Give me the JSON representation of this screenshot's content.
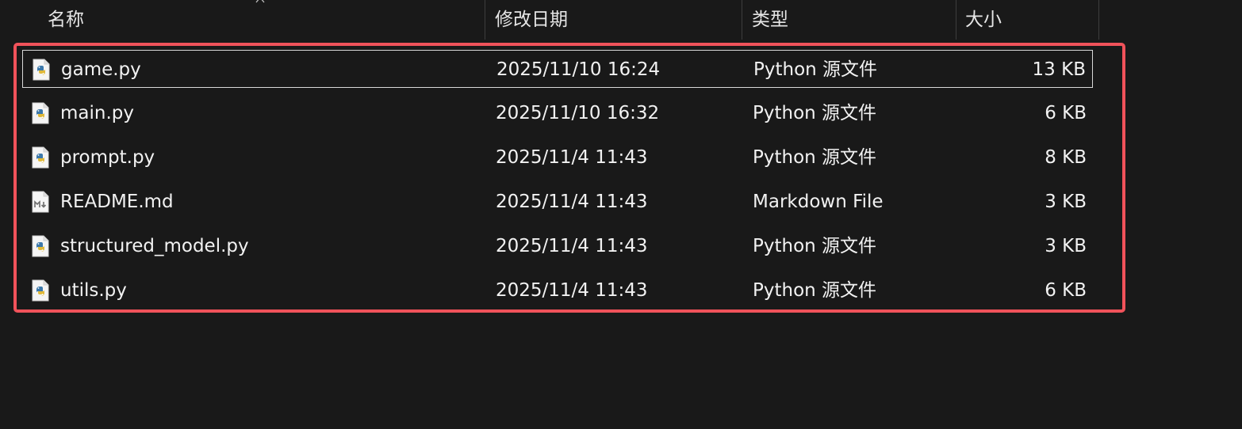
{
  "columns": {
    "name": "名称",
    "date": "修改日期",
    "type": "类型",
    "size": "大小"
  },
  "sort_indicator_icon": "caret-up-icon",
  "highlight_color": "#f0525a",
  "files": [
    {
      "name": "game.py",
      "date": "2025/11/10 16:24",
      "type": "Python 源文件",
      "size": "13 KB",
      "icon": "python-file-icon",
      "selected": true
    },
    {
      "name": "main.py",
      "date": "2025/11/10 16:32",
      "type": "Python 源文件",
      "size": "6 KB",
      "icon": "python-file-icon",
      "selected": false
    },
    {
      "name": "prompt.py",
      "date": "2025/11/4 11:43",
      "type": "Python 源文件",
      "size": "8 KB",
      "icon": "python-file-icon",
      "selected": false
    },
    {
      "name": "README.md",
      "date": "2025/11/4 11:43",
      "type": "Markdown File",
      "size": "3 KB",
      "icon": "markdown-file-icon",
      "selected": false
    },
    {
      "name": "structured_model.py",
      "date": "2025/11/4 11:43",
      "type": "Python 源文件",
      "size": "3 KB",
      "icon": "python-file-icon",
      "selected": false
    },
    {
      "name": "utils.py",
      "date": "2025/11/4 11:43",
      "type": "Python 源文件",
      "size": "6 KB",
      "icon": "python-file-icon",
      "selected": false
    }
  ]
}
